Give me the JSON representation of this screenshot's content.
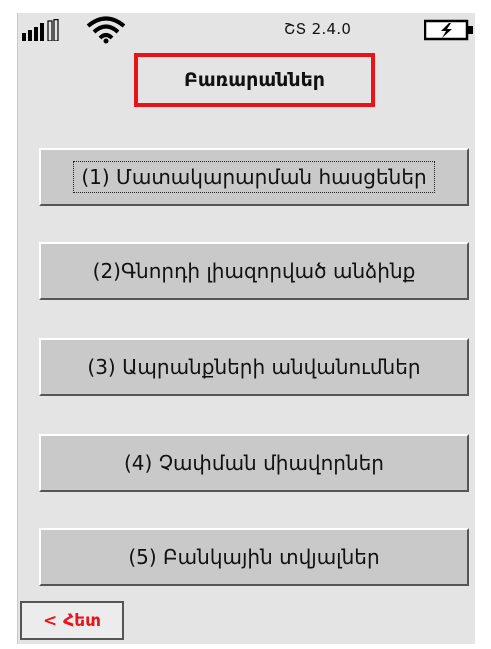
{
  "status_bar": {
    "os_version": "ՇՏ 2.4.0"
  },
  "header": {
    "title": "Բառարաններ"
  },
  "menu": {
    "items": [
      {
        "label": "(1) Մատակարարման հասցեներ"
      },
      {
        "label": "(2)Գնորդի լիազորված անձինք"
      },
      {
        "label": "(3) Ապրանքների անվանումներ"
      },
      {
        "label": "(4) Չափման միավորներ"
      },
      {
        "label": "(5) Բանկային տվյալներ"
      }
    ]
  },
  "footer": {
    "back_label": "< Հետ"
  },
  "colors": {
    "accent": "#e8141a",
    "screen_background": "#e4e4e4",
    "button_face": "#c9c9c9"
  },
  "icons": [
    "signal-icon",
    "wifi-icon",
    "battery-charging-icon"
  ]
}
